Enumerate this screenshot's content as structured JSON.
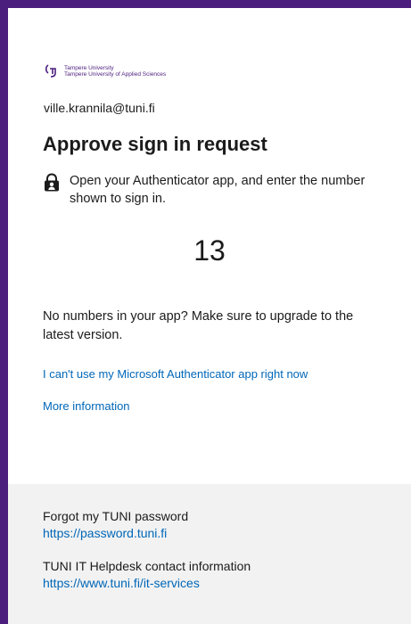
{
  "logo": {
    "line1": "Tampere University",
    "line2": "Tampere University of Applied Sciences",
    "icon": "tampere-logo-icon"
  },
  "account": {
    "email": "ville.krannila@tuni.fi"
  },
  "header": {
    "title": "Approve sign in request"
  },
  "instruction": {
    "icon": "authenticator-lock-icon",
    "text": "Open your Authenticator app, and enter the number shown to sign in."
  },
  "challenge": {
    "number": "13"
  },
  "upgrade_note": "No numbers in your app? Make sure to upgrade to the latest version.",
  "links": {
    "cant_use": "I can't use my Microsoft Authenticator app right now",
    "more_info": "More information"
  },
  "footer": {
    "password_label": "Forgot my TUNI password",
    "password_url": "https://password.tuni.fi",
    "helpdesk_label": "TUNI IT Helpdesk contact information",
    "helpdesk_url": "https://www.tuni.fi/it-services"
  },
  "colors": {
    "frame": "#4b1e7e",
    "link": "#0067b8",
    "footer_bg": "#f2f2f2",
    "text": "#1b1b1b"
  }
}
